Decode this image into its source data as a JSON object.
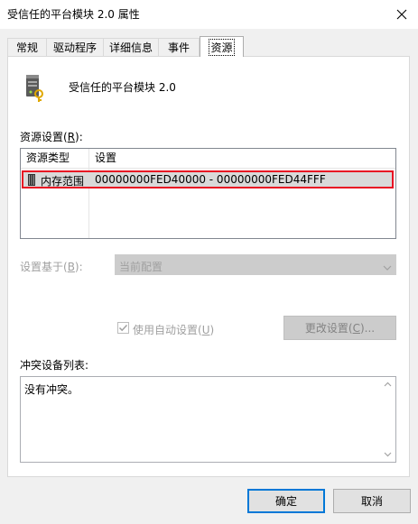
{
  "window": {
    "title": "受信任的平台模块 2.0 属性"
  },
  "tabs": [
    {
      "label": "常规"
    },
    {
      "label": "驱动程序"
    },
    {
      "label": "详细信息"
    },
    {
      "label": "事件"
    },
    {
      "label": "资源"
    }
  ],
  "device": {
    "name": "受信任的平台模块 2.0",
    "icon": "tpm-chip-icon"
  },
  "resource_settings": {
    "label": "资源设置(",
    "hotkey": "R",
    "label_end": "):",
    "columns": [
      "资源类型",
      "设置"
    ],
    "rows": [
      {
        "type": "内存范围",
        "setting": "00000000FED40000 - 00000000FED44FFF"
      }
    ]
  },
  "based_on": {
    "label": "设置基于(",
    "hotkey": "B",
    "label_end": "):",
    "value": "当前配置"
  },
  "auto_settings": {
    "label": "使用自动设置(",
    "hotkey": "U",
    "label_end": ")",
    "checked": true
  },
  "change_button": {
    "label": "更改设置(",
    "hotkey": "C",
    "label_end": ")..."
  },
  "conflicts": {
    "label": "冲突设备列表:",
    "text": "没有冲突。"
  },
  "buttons": {
    "ok": "确定",
    "cancel": "取消"
  },
  "colors": {
    "highlight_border": "#e81123",
    "default_button": "#0078d7"
  }
}
